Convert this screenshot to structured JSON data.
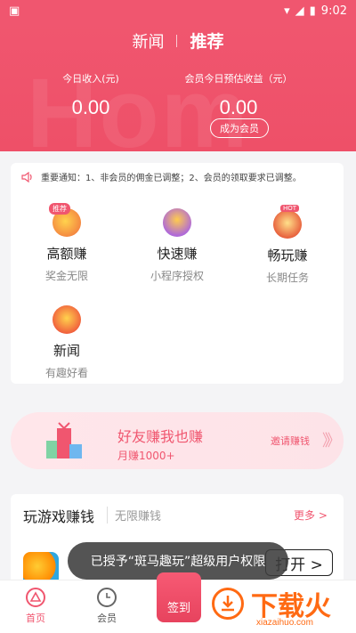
{
  "status": {
    "time": "9:02"
  },
  "header": {
    "tabs": [
      "新闻",
      "推荐"
    ],
    "watermark": "Hom",
    "today_income_label": "今日收入(元)",
    "today_income_value": "0.00",
    "member_label": "会员今日预估收益（元）",
    "member_value": "0.00",
    "become_member": "成为会员"
  },
  "notice": "重要通知：1、非会员的佣金已调整；2、会员的领取要求已调整。",
  "features": [
    {
      "title": "高额赚",
      "sub": "奖金无限",
      "badge": "推荐"
    },
    {
      "title": "快速赚",
      "sub": "小程序授权"
    },
    {
      "title": "畅玩赚",
      "sub": "长期任务",
      "badge": "HOT"
    },
    {
      "title": "新闻",
      "sub": "有趣好看"
    }
  ],
  "banner": {
    "title": "好友赚我也赚",
    "sub": "月赚1000+",
    "invite": "邀请赚钱",
    "arrows": "》》"
  },
  "games": {
    "title": "玩游戏赚钱",
    "sub": "无限赚钱",
    "more": "更多 >",
    "open": "打开 >"
  },
  "toast": "已授予“斑马趣玩”超级用户权限",
  "nav": {
    "home": "首页",
    "member": "会员",
    "signin": "签到"
  },
  "watermark": {
    "big": "下载火",
    "small": "xiazaihuo.com"
  },
  "colors": {
    "accent": "#f0566f"
  }
}
